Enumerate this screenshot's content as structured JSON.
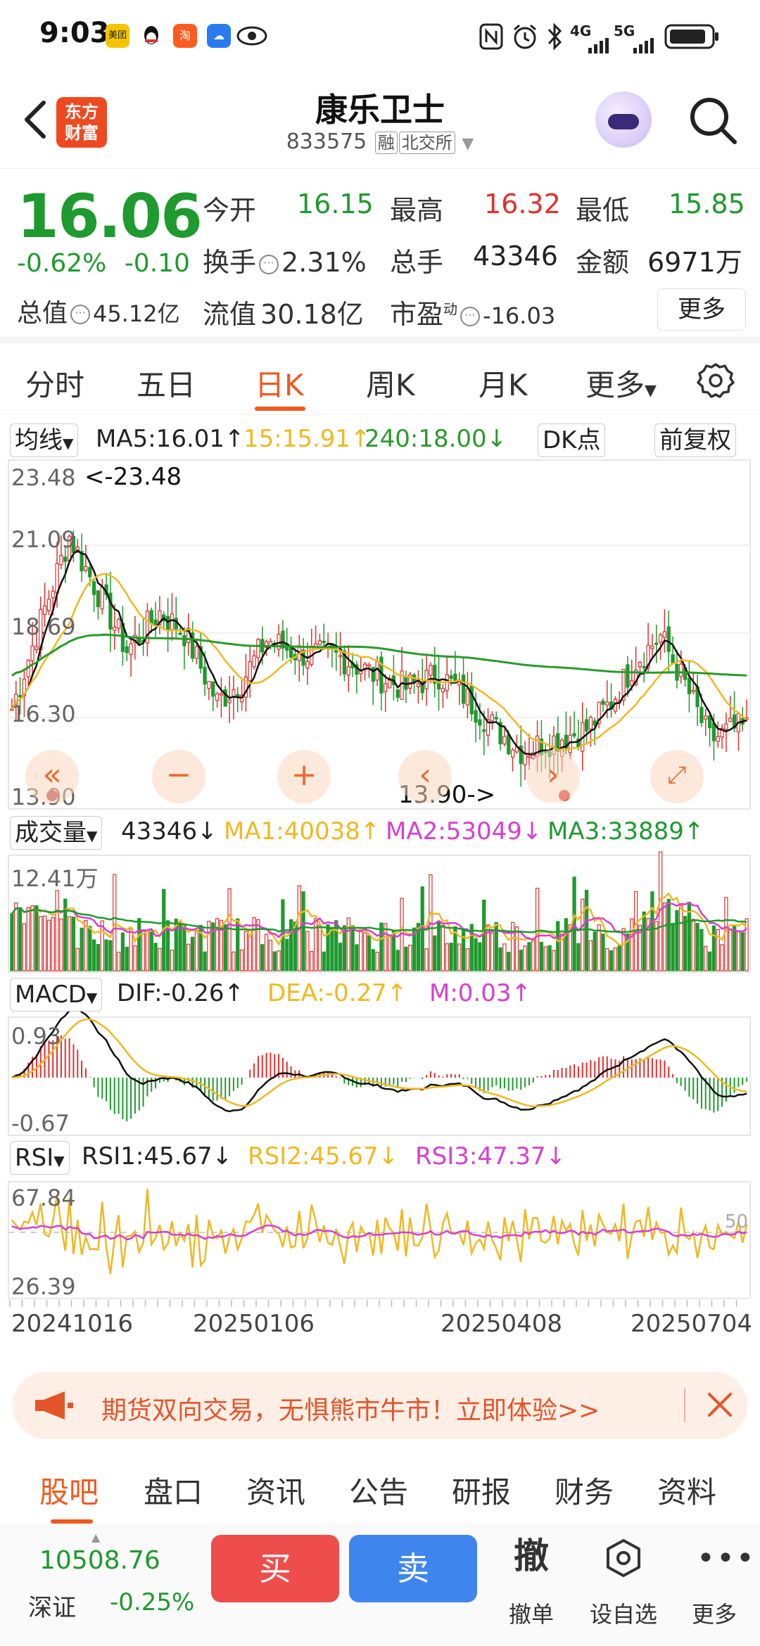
{
  "status_bar": {
    "time": "9:03",
    "app_icons": [
      "美团",
      "QQ",
      "淘",
      "云",
      "eye"
    ],
    "network": "4G",
    "network2": "5G",
    "battery_icon": "battery-icon"
  },
  "header": {
    "logo_line1": "东方",
    "logo_line2": "财富",
    "stock_name": "康乐卫士",
    "stock_code": "833575",
    "tag_margin": "融",
    "tag_exchange": "北交所"
  },
  "quote": {
    "price": "16.06",
    "change_pct": "-0.62%",
    "change": "-0.10",
    "open_label": "今开",
    "open": "16.15",
    "high_label": "最高",
    "high": "16.32",
    "low_label": "最低",
    "low": "15.85",
    "turnover_label": "换手",
    "turnover": "2.31%",
    "volume_label": "总手",
    "volume": "43346",
    "amount_label": "金额",
    "amount": "6971万",
    "mktcap_label": "总值",
    "mktcap": "45.12亿",
    "float_label": "流值",
    "float": "30.18亿",
    "pe_label": "市盈",
    "pe_sup": "动",
    "pe": "-16.03",
    "more": "更多"
  },
  "period_tabs": [
    "分时",
    "五日",
    "日K",
    "周K",
    "月K",
    "更多"
  ],
  "active_period": "日K",
  "kline": {
    "ma_select": "均线",
    "ma5": "MA5:16.01↑",
    "ma15": "15:15.91↑",
    "ma240": "240:18.00↓",
    "dk_btn": "DK点",
    "adjust_btn": "前复权",
    "y_max": "23.48",
    "y_2": "21.09",
    "y_3": "18.69",
    "y_4": "16.30",
    "y_min": "13.90",
    "max_marker": "<-23.48",
    "min_marker": "13.90->",
    "colors": {
      "up": "#e0302e",
      "down": "#1e9a2e",
      "ma5": "#111111",
      "ma15": "#f0b820",
      "ma240": "#2a9a2a"
    }
  },
  "volume": {
    "select": "成交量",
    "value": "43346↓",
    "ma1": "MA1:40038↑",
    "ma2": "MA2:53049↓",
    "ma3": "MA3:33889↑",
    "y_max": "12.41万"
  },
  "macd": {
    "select": "MACD",
    "dif": "DIF:-0.26↑",
    "dea": "DEA:-0.27↑",
    "m": "M:0.03↑",
    "y_max": "0.93",
    "y_min": "-0.67"
  },
  "rsi": {
    "select": "RSI",
    "rsi1": "RSI1:45.67↓",
    "rsi2": "RSI2:45.67↓",
    "rsi3": "RSI3:47.37↓",
    "y_max": "67.84",
    "y_min": "26.39",
    "mid": "50"
  },
  "dates": [
    "20241016",
    "20250106",
    "20250408",
    "20250704"
  ],
  "ad": {
    "text": "期货双向交易，无惧熊市牛市！立即体验>>"
  },
  "bottom_tabs": [
    "股吧",
    "盘口",
    "资讯",
    "公告",
    "研报",
    "财务",
    "资料"
  ],
  "active_bottom_tab": "股吧",
  "footer": {
    "index_value": "10508.76",
    "index_name": "深证",
    "index_change": "-0.25%",
    "buy": "买",
    "sell": "卖",
    "cancel_icon": "撤",
    "cancel_label": "撤单",
    "watch_label": "设自选",
    "more_label": "更多"
  }
}
